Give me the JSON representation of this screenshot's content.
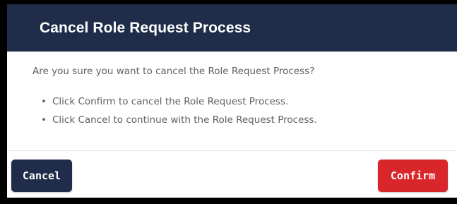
{
  "dialog": {
    "title": "Cancel Role Request Process",
    "question": "Are you sure you want to cancel the Role Request Process?",
    "bullets": [
      "Click Confirm to cancel the Role Request Process.",
      "Click Cancel to continue with the Role Request Process."
    ],
    "bullet_glyph": "•",
    "cancel_label": "Cancel",
    "confirm_label": "Confirm"
  },
  "colors": {
    "header_bg": "#1f2d4a",
    "cancel_bg": "#1f2d4a",
    "confirm_bg": "#d9262a",
    "text": "#5f5f5f"
  }
}
